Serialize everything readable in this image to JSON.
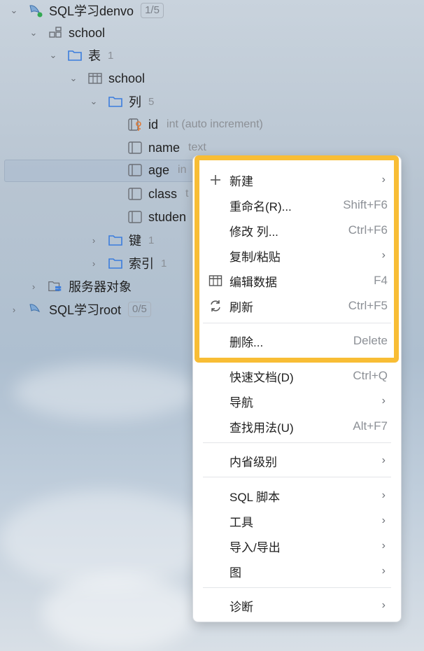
{
  "tree": {
    "connection1": {
      "name": "SQL学习denvo",
      "badge": "1/5"
    },
    "schema": {
      "name": "school"
    },
    "tables_folder": {
      "name": "表",
      "count": "1"
    },
    "table": {
      "name": "school"
    },
    "columns_folder": {
      "name": "列",
      "count": "5"
    },
    "columns": [
      {
        "name": "id",
        "type": "int (auto increment)"
      },
      {
        "name": "name",
        "type": "text"
      },
      {
        "name": "age",
        "type": "in"
      },
      {
        "name": "class",
        "type": "t"
      },
      {
        "name": "studen",
        "type": ""
      }
    ],
    "keys_folder": {
      "name": "键",
      "count": "1"
    },
    "indexes_folder": {
      "name": "索引",
      "count": "1"
    },
    "server_objects": {
      "name": "服务器对象"
    },
    "connection2": {
      "name": "SQL学习root",
      "badge": "0/5"
    }
  },
  "menu": {
    "new": {
      "label": "新建"
    },
    "rename": {
      "label": "重命名(R)...",
      "shortcut": "Shift+F6"
    },
    "modify": {
      "label": "修改 列...",
      "shortcut": "Ctrl+F6"
    },
    "copy_paste": {
      "label": "复制/粘贴"
    },
    "edit_data": {
      "label": "编辑数据",
      "shortcut": "F4"
    },
    "refresh": {
      "label": "刷新",
      "shortcut": "Ctrl+F5"
    },
    "delete": {
      "label": "删除...",
      "shortcut": "Delete"
    },
    "quick_doc": {
      "label": "快速文档(D)",
      "shortcut": "Ctrl+Q"
    },
    "navigate": {
      "label": "导航"
    },
    "find_usages": {
      "label": "查找用法(U)",
      "shortcut": "Alt+F7"
    },
    "introspection": {
      "label": "内省级别"
    },
    "sql_script": {
      "label": "SQL 脚本"
    },
    "tools": {
      "label": "工具"
    },
    "import_export": {
      "label": "导入/导出"
    },
    "diagram": {
      "label": "图"
    },
    "diagnostics": {
      "label": "诊断"
    }
  },
  "colors": {
    "highlight": "#f8bd35",
    "folder": "#3b7ddd",
    "key": "#e07b39"
  }
}
